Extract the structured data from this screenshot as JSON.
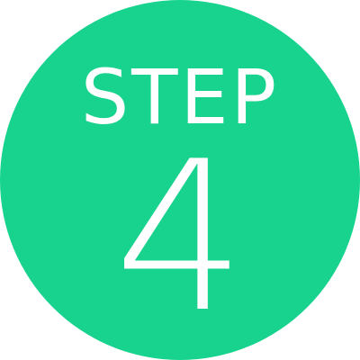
{
  "badge": {
    "label": "STEP",
    "number": "4",
    "background_color": "#17D38D",
    "text_color": "#FFFFFF"
  }
}
